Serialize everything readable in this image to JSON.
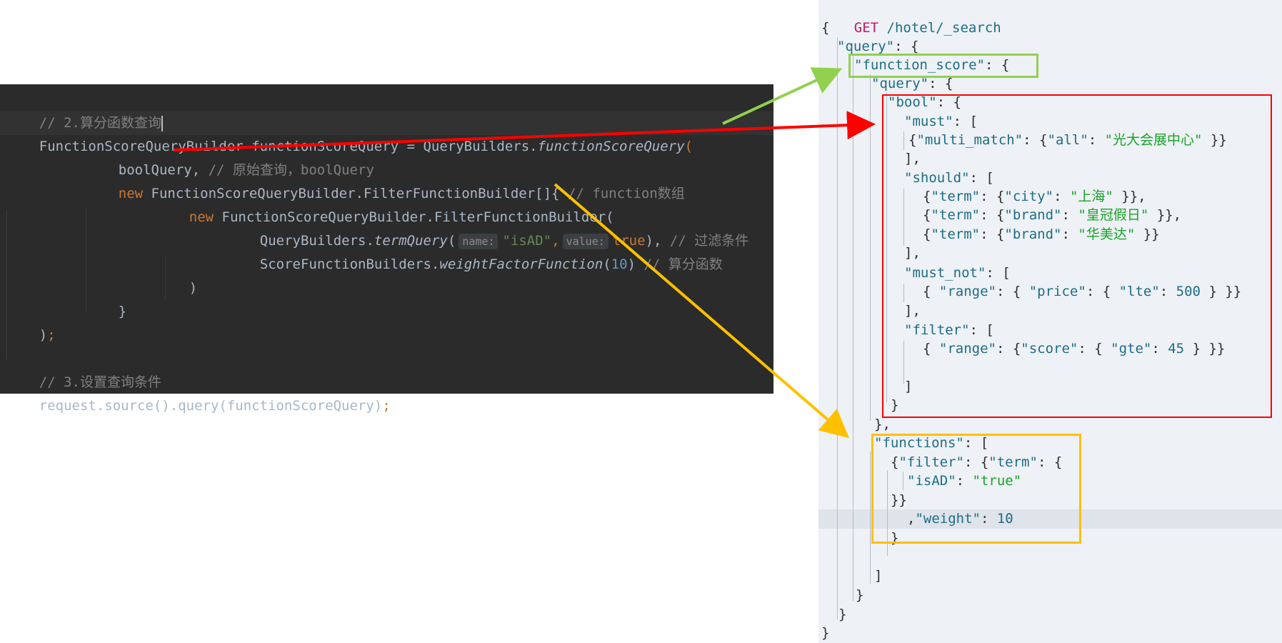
{
  "java_editor": {
    "lines": [
      {
        "comment": "// 2.算分函数查询"
      },
      {
        "class_name": "FunctionScoreQueryBuilder",
        "var_name": "functionScoreQuery",
        "eq": "=",
        "receiver": "QueryBuilders.",
        "method": "functionScoreQuery",
        "paren": "("
      },
      {
        "code": "boolQuery,",
        "comment": "// 原始查询，boolQuery"
      },
      {
        "kw": "new",
        "code": "FunctionScoreQueryBuilder.FilterFunctionBuilder[]{",
        "comment": "// function数组"
      },
      {
        "kw": "new",
        "code": "FunctionScoreQueryBuilder.FilterFunctionBuilder("
      },
      {
        "receiver": "QueryBuilders.",
        "method": "termQuery",
        "paren": "(",
        "hint1": "name:",
        "str": "\"isAD\"",
        "comma": ",",
        "hint2": "value:",
        "kw": "true",
        "close": "),",
        "comment": "// 过滤条件"
      },
      {
        "receiver": "ScoreFunctionBuilders.",
        "method": "weightFactorFunction",
        "paren": "(",
        "num": "10",
        "close": ")",
        "comment": "// 算分函数"
      },
      {
        "code": ")"
      },
      {
        "code": "}"
      },
      {
        "code": ")",
        "semi": ";"
      },
      {
        "comment": "// 3.设置查询条件"
      },
      {
        "code": "request.source().query(functionScoreQuery)",
        "semi": ";"
      }
    ]
  },
  "dsl_editor": {
    "request": {
      "method": "GET",
      "path": "/hotel/_search"
    },
    "lines": [
      {
        "t": "{"
      },
      {
        "k": "\"query\"",
        "t": ": {"
      },
      {
        "k": "\"function_score\"",
        "t": ": {"
      },
      {
        "k": "\"query\"",
        "t": ": {"
      },
      {
        "k": "\"bool\"",
        "t": ": {"
      },
      {
        "k": "\"must\"",
        "t": ": ["
      },
      {
        "t1": "{",
        "k": "\"multi_match\"",
        "t2": ": {",
        "k2": "\"all\"",
        "t3": ": ",
        "v": "\"光大会展中心\"",
        "t4": " }}"
      },
      {
        "t": "],"
      },
      {
        "k": "\"should\"",
        "t": ": ["
      },
      {
        "t1": "{",
        "k": "\"term\"",
        "t2": ": {",
        "k2": "\"city\"",
        "t3": ": ",
        "v": "\"上海\"",
        "t4": " }},"
      },
      {
        "t1": "{",
        "k": "\"term\"",
        "t2": ": {",
        "k2": "\"brand\"",
        "t3": ": ",
        "v": "\"皇冠假日\"",
        "t4": " }},"
      },
      {
        "t1": "{",
        "k": "\"term\"",
        "t2": ": {",
        "k2": "\"brand\"",
        "t3": ": ",
        "v": "\"华美达\"",
        "t4": " }}"
      },
      {
        "t": "],"
      },
      {
        "k": "\"must_not\"",
        "t": ": ["
      },
      {
        "t1": "{ ",
        "k": "\"range\"",
        "t2": ": { ",
        "k2": "\"price\"",
        "t3": ": { ",
        "k3": "\"lte\"",
        "t4": ": ",
        "n": "500",
        "t5": " } }}"
      },
      {
        "t": "],"
      },
      {
        "k": "\"filter\"",
        "t": ": ["
      },
      {
        "t1": "{ ",
        "k": "\"range\"",
        "t2": ": {",
        "k2": "\"score\"",
        "t3": ": { ",
        "k3": "\"gte\"",
        "t4": ": ",
        "n": "45",
        "t5": " } }}"
      },
      {
        "t": ""
      },
      {
        "t": "]"
      },
      {
        "t": "}"
      },
      {
        "t": "},"
      },
      {
        "k": "\"functions\"",
        "t": ": ["
      },
      {
        "t1": "{",
        "k": "\"filter\"",
        "t2": ": {",
        "k2": "\"term\"",
        "t3": ": {"
      },
      {
        "k": "\"isAD\"",
        "t": ": ",
        "v": "\"true\""
      },
      {
        "t": "}}"
      },
      {
        "t1": ",",
        "k": "\"weight\"",
        "t2": ": ",
        "n": "10"
      },
      {
        "t": "}"
      },
      {
        "t": ""
      },
      {
        "t": "]"
      },
      {
        "t": "}"
      },
      {
        "t": "}"
      },
      {
        "t": "}"
      }
    ]
  },
  "annotations": {
    "colors": {
      "green": "#92d050",
      "red": "#ff0000",
      "yellow": "#ffc000"
    }
  }
}
